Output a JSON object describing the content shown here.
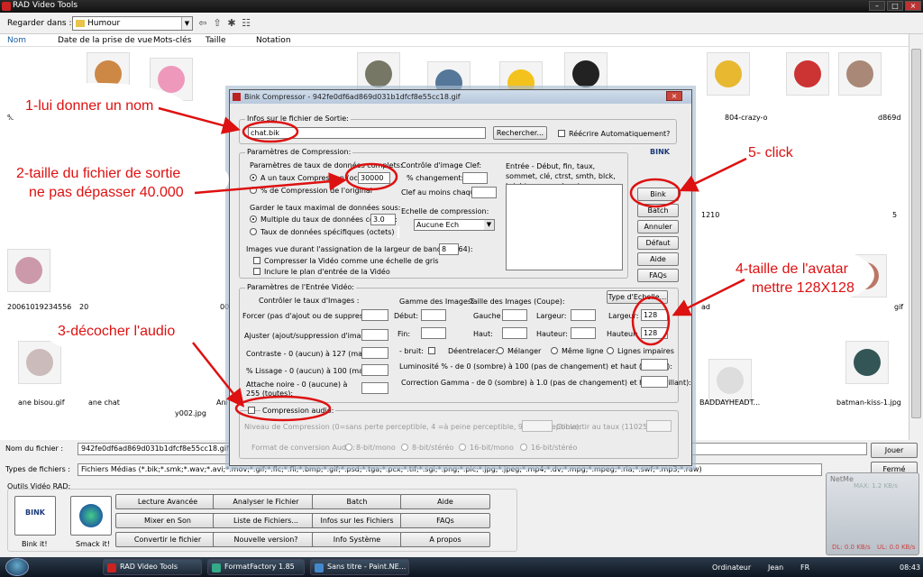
{
  "window": {
    "title": "RAD Video Tools"
  },
  "lookin": {
    "label": "Regarder dans :",
    "folder": "Humour"
  },
  "columns": [
    "Nom",
    "Date de la prise de vue",
    "Mots-clés",
    "Taille",
    "Notation"
  ],
  "captions": {
    "c1": "%5",
    "c2": "804-crazy-o",
    "c3": "d869d",
    "c4": "1210",
    "c5": "5",
    "c6": "20061019234556",
    "c7": "20",
    "c8": "00",
    "c9": "ad",
    "c10": "gif",
    "c11": "ane bisou.gif",
    "c12": "ane chat",
    "c13": "y002.jpg",
    "c14": "Ani",
    "c15": "BADDAYHEADT...",
    "c16": "batman-kiss-1.jpg"
  },
  "bottom": {
    "filename_label": "Nom du fichier :",
    "filename_value": "942fe0df6ad869d031b1dfcf8e55cc18.gif",
    "filetypes_label": "Types de fichiers :",
    "filetypes_value": "Fichiers Médias (*.bik;*.smk;*.wav;*.avi;*.mov;*.gif;*.flc;*.fli;*.bmp;*.gif;*.psd;*.tga;*.pcx;*.tif;*.sgi;*.png;*.pic;*.jpg;*.jpeg;*.mp4;*.dv;*.mpg;*.mpeg;*.ria;*.swf;*.mp3;*.raw)",
    "play_button": "Jouer",
    "close_button": "Fermé",
    "tools_label": "Outils Vidéo RAD:",
    "bink_label": "Bink it!",
    "smack_label": "Smack it!",
    "buttons": [
      "Lecture Avancée",
      "Analyser le Fichier",
      "Batch",
      "Aide",
      "Mixer en Son",
      "Liste de Fichiers...",
      "Infos sur les Fichiers",
      "FAQs",
      "Convertir le fichier",
      "Nouvelle version?",
      "Info Système",
      "A propos"
    ]
  },
  "netmeter": {
    "label": "NetMe",
    "scale": "MAX: 1.2 KB/s",
    "dl": "DL: 0.0 KB/s",
    "ul": "UL: 0.0 KB/s"
  },
  "taskbar": {
    "tasks": [
      "RAD Video Tools",
      "FormatFactory 1.85",
      "Sans titre - Paint.NE..."
    ],
    "user": "Ordinateur",
    "name": "Jean",
    "lang": "FR",
    "clock": "08:43"
  },
  "dialog": {
    "title": "Bink Compressor - 942fe0df6ad869d031b1dfcf8e55cc18.gif",
    "output_group": "Infos sur le fichier de Sortie:",
    "output_file": "chat.bik",
    "browse_button": "Rechercher...",
    "auto_overwrite": "Réécrire Automatiquement?",
    "compression_group": "Paramètres de Compression:",
    "rate_params": "Paramètres de taux de données complets:",
    "rate_fixed": "A un taux Compression (octets):",
    "rate_fixed_value": "30000",
    "rate_percent": "% de Compression de l'original",
    "max_rate": "Garder le taux maximal de données sous:",
    "multiple_rate": "Multiple du taux de données complet:",
    "multiple_rate_value": "3.0",
    "specific_rate": "Taux de données spécifiques (octets)",
    "keyframe": "Contrôle d'image Clef:",
    "pct_change": "% changement:",
    "keyframe_min": "Clef au moins chaque:",
    "scale": "Echelle de compression:",
    "scale_value": "Aucune Ech",
    "entry_text": "Entrée - Début, fin, taux, sommet, clé, ctrst, smth, blck, bright, gmma, denoise:",
    "images_bw": "Images vue durant l'assignation de la largeur de bande (2-64):",
    "images_bw_value": "8",
    "grayscale": "Compresser la Vidéo comme une échelle de gris",
    "include_plan": "Inclure le plan d'entrée de la Vidéo",
    "side_buttons": [
      "Bink",
      "Batch",
      "Annuler",
      "Défaut",
      "Aide",
      "FAQs"
    ],
    "video_group": "Paramètres de l'Entrée Vidéo:",
    "ctrl_rate": "Contrôler le taux d'Images :",
    "force_rate": "Forcer (pas d'ajout ou de suppression):",
    "adjust_rate": "Ajuster (ajout/suppression d'images)",
    "image_range": "Gamme des Images:",
    "start": "Début:",
    "end": "Fin:",
    "crop": "Taille des Images (Coupe):",
    "left": "Gauche",
    "top": "Haut:",
    "width_l": "Largeur:",
    "height_l": "Hauteur:",
    "scale_type": "Type d'Echelle...",
    "width_r": "Largeur:",
    "height_r": "Hauteur:",
    "width_value": "128",
    "height_value": "128",
    "contrast": "Contraste - 0 (aucun) à 127 (max):",
    "smoothing": "% Lissage - 0 (aucun) à 100 (max):",
    "black": "Attache noire - 0 (aucune) à 255 (toutes):",
    "noise": "- bruit:",
    "deinterlace": "Déentrelacer:",
    "mix": "Mélanger",
    "same_line": "Même ligne",
    "odd_lines": "Lignes impaires",
    "brightness": "Luminosité % - de 0 (sombre) à 100 (pas de changement) et haut (brillant):",
    "gamma": "Correction Gamma - de 0 (sombre) à 1.0 (pas de changement) et haut (brillant):",
    "audio": "Compression audio:",
    "audio_level": "Niveau de Compression (0=sans perte perceptible, 4 =à peine perceptible, 99 =perceptible):",
    "audio_convert": "Convertir au taux (11025, etc):",
    "audio_format": "Format de conversion Audio:",
    "fmt1": "8-bit/mono",
    "fmt2": "8-bit/stéréo",
    "fmt3": "16-bit/mono",
    "fmt4": "16-bit/stéréo"
  },
  "annotations": {
    "a1": "1-lui donner un nom",
    "a2a": "2-taille du fichier de sortie",
    "a2b": "ne pas dépasser 40.000",
    "a3": "3-décocher l'audio",
    "a4a": "4-taille de l'avatar",
    "a4b": "mettre 128X128",
    "a5": "5- click"
  },
  "colors": {
    "annotation": "#dd1111",
    "titlebar": "#1a1a1a",
    "dialog_bg": "#ececec"
  }
}
